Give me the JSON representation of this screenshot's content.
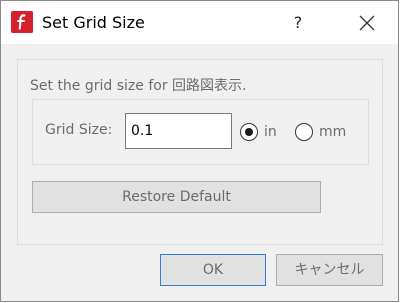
{
  "window": {
    "title": "Set Grid Size",
    "help_label": "?",
    "close_label": "close",
    "accent_color": "#d3202a",
    "icon": "app-logo-icon"
  },
  "content": {
    "description": "Set the grid size for 回路図表示.",
    "grid_size": {
      "label": "Grid Size:",
      "value": "0.1"
    },
    "units": [
      {
        "label": "in",
        "selected": true
      },
      {
        "label": "mm",
        "selected": false
      }
    ],
    "restore_label": "Restore Default"
  },
  "footer": {
    "ok_label": "OK",
    "cancel_label": "キャンセル",
    "focus_color": "#2c7fd1"
  }
}
